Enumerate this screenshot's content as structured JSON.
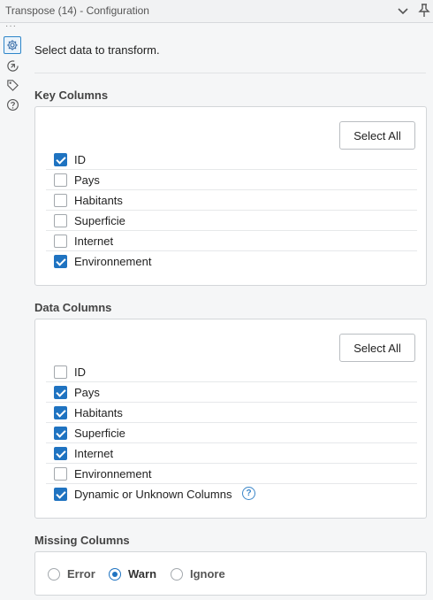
{
  "window": {
    "title": "Transpose (14) - Configuration",
    "collapse_icon": "chevron-down-icon",
    "pin_icon": "pin-icon"
  },
  "sidebar": {
    "items": [
      {
        "name": "configuration",
        "icon": "gear-icon",
        "active": true
      },
      {
        "name": "annotation",
        "icon": "refresh-icon",
        "active": false
      },
      {
        "name": "tags",
        "icon": "tag-icon",
        "active": false
      },
      {
        "name": "help",
        "icon": "question-icon",
        "active": false
      }
    ]
  },
  "main": {
    "prompt": "Select data to transform.",
    "key_columns": {
      "title": "Key Columns",
      "select_all_label": "Select All",
      "items": [
        {
          "label": "ID",
          "checked": true
        },
        {
          "label": "Pays",
          "checked": false
        },
        {
          "label": "Habitants",
          "checked": false
        },
        {
          "label": "Superficie",
          "checked": false
        },
        {
          "label": "Internet",
          "checked": false
        },
        {
          "label": "Environnement",
          "checked": true
        }
      ]
    },
    "data_columns": {
      "title": "Data Columns",
      "select_all_label": "Select All",
      "items": [
        {
          "label": "ID",
          "checked": false
        },
        {
          "label": "Pays",
          "checked": true
        },
        {
          "label": "Habitants",
          "checked": true
        },
        {
          "label": "Superficie",
          "checked": true
        },
        {
          "label": "Internet",
          "checked": true
        },
        {
          "label": "Environnement",
          "checked": false
        },
        {
          "label": "Dynamic or Unknown Columns",
          "checked": true,
          "help": true
        }
      ]
    },
    "missing_columns": {
      "title": "Missing Columns",
      "options": [
        {
          "label": "Error",
          "selected": false
        },
        {
          "label": "Warn",
          "selected": true
        },
        {
          "label": "Ignore",
          "selected": false
        }
      ]
    }
  },
  "colors": {
    "accent": "#1f73c1",
    "background": "#f5f6f7",
    "box_border": "#d3d6d9"
  }
}
